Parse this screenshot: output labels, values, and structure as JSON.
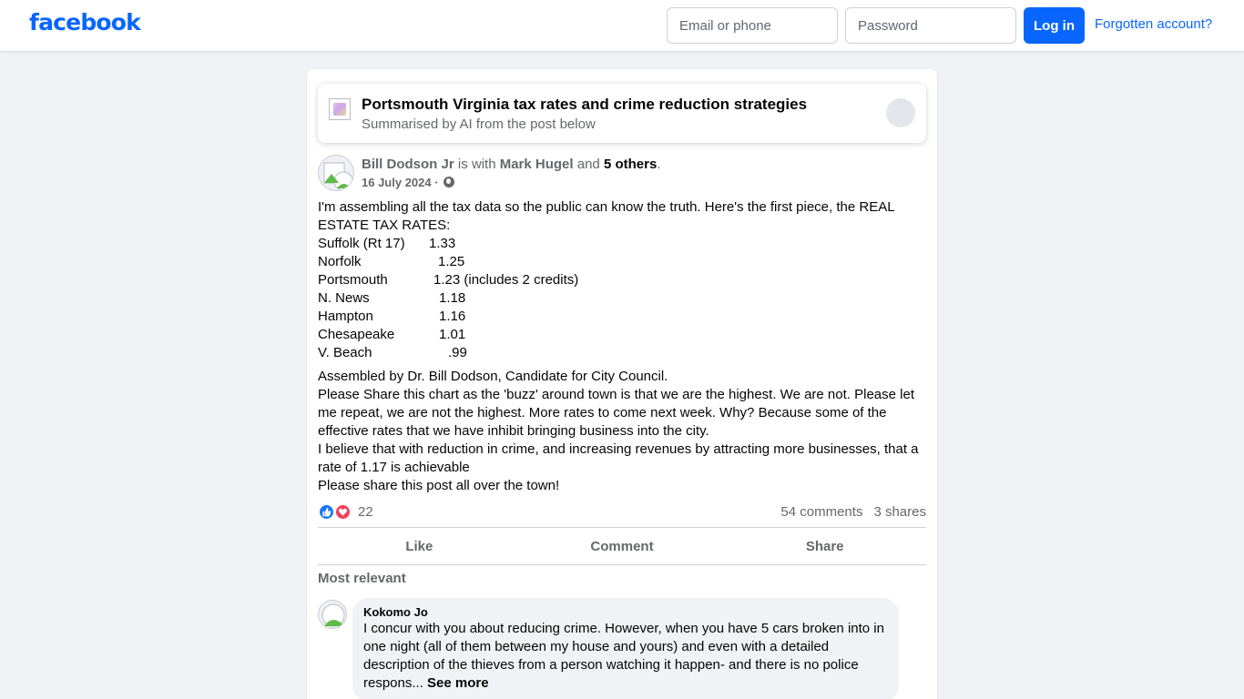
{
  "header": {
    "logo": "facebook",
    "email_placeholder": "Email or phone",
    "password_placeholder": "Password",
    "login_label": "Log in",
    "forgot_label": "Forgotten account?"
  },
  "ai_summary": {
    "title": "Portsmouth Virginia tax rates and crime reduction strategies",
    "subtitle": "Summarised by AI from the post below"
  },
  "post": {
    "author": "Bill Dodson Jr",
    "with_text": " is with ",
    "tagged": "Mark Hugel",
    "and_text": " and ",
    "others": "5 others",
    "period": ".",
    "date": "16 July 2024",
    "date_sep": " · ",
    "intro_line1": "I'm assembling all the tax data so the public can know the truth.  Here's the first piece, the REAL",
    "intro_line2": "ESTATE TAX RATES:",
    "tax_rates": [
      {
        "city": "Suffolk (Rt 17)",
        "rate": "1.33"
      },
      {
        "city": "Norfolk",
        "rate": "1.25"
      },
      {
        "city": "Portsmouth",
        "rate": "1.23  (includes 2 credits)"
      },
      {
        "city": "N. News",
        "rate": "1.18"
      },
      {
        "city": "Hampton",
        "rate": "1.16"
      },
      {
        "city": "Chesapeake",
        "rate": "1.01"
      },
      {
        "city": "V. Beach",
        "rate": ".99"
      }
    ],
    "body_lines": [
      "Assembled by Dr. Bill Dodson, Candidate for City Council.",
      "Please Share this chart as the 'buzz' around town is that we are the highest.  We are not.  Please let",
      "me repeat, we are not the highest.  More rates to come next week.  Why? Because some of the",
      "effective rates that we have inhibit bringing business into the city.",
      "I believe that with reduction in crime, and increasing revenues by attracting more businesses, that a",
      "rate of 1.17 is achievable",
      "Please share this post all over the town!"
    ],
    "reaction_count": "22",
    "comments_count": "54 comments",
    "shares_count": "3 shares"
  },
  "actions": {
    "like": "Like",
    "comment": "Comment",
    "share": "Share"
  },
  "comments": {
    "sort_label": "Most relevant",
    "items": [
      {
        "name": "Kokomo Jo",
        "lines": [
          "I concur with you about reducing crime. However, when you have 5 cars broken into in",
          "one night (all of them between my house and yours) and even with a detailed",
          "description of the thieves from a person watching it happen- and there is no police",
          "respons..."
        ],
        "see_more": "See more"
      }
    ]
  },
  "icons": {
    "like_reaction": "thumbs-up-icon",
    "love_reaction": "heart-icon",
    "privacy": "globe-icon",
    "ai": "ai-sparkle-icon"
  },
  "colors": {
    "brand": "#0866ff",
    "like": "#1877f2",
    "love": "#f33e58",
    "background": "#f0f2f5",
    "secondary_text": "#65676b"
  }
}
